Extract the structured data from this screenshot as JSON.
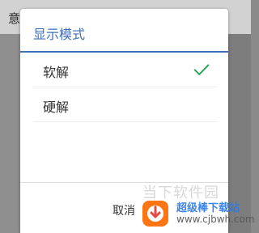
{
  "background": {
    "header_text": "意"
  },
  "dialog": {
    "title": "显示模式",
    "options": [
      {
        "label": "软解",
        "selected": true
      },
      {
        "label": "硬解",
        "selected": false
      }
    ],
    "cancel_label": "取消"
  },
  "watermark": {
    "site_name": "当下软件园",
    "brand": "超级棒下载站",
    "url": "www.cjbwh.com"
  },
  "colors": {
    "accent": "#3f6fb8",
    "check": "#2ea55f"
  },
  "icons": {
    "check": "check-icon"
  }
}
